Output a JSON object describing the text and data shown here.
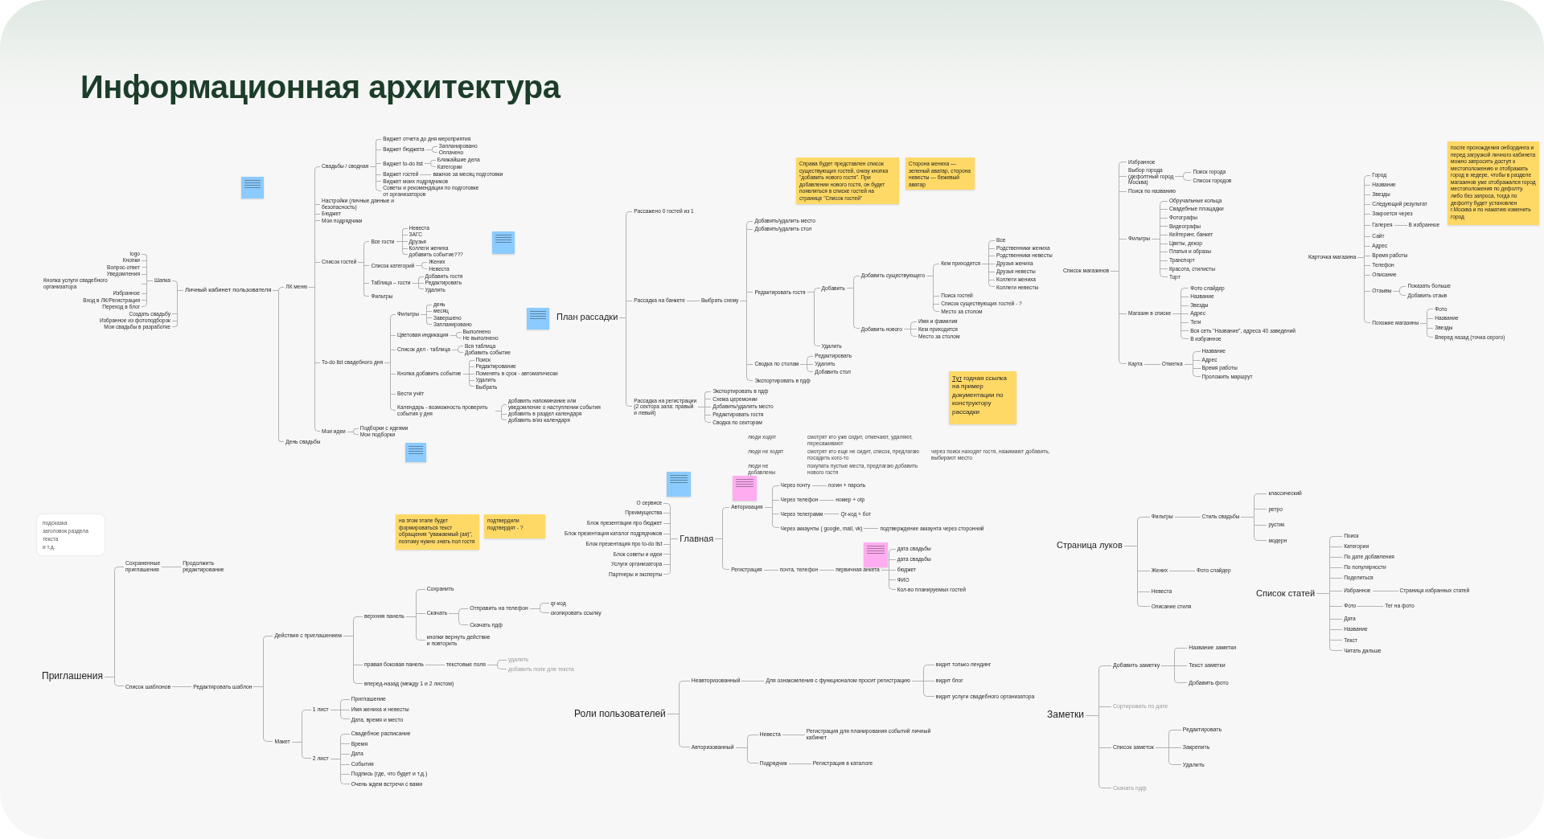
{
  "title": "Информационная архитектура",
  "maps": [
    {
      "title": "Личный кабинет пользователя",
      "left_children": [
        {
          "label": "Шапка",
          "children": [
            {
              "label": "logo"
            },
            {
              "label": "Кнопки"
            },
            {
              "label": "Вопрос-ответ"
            },
            {
              "label": "Уведомления"
            },
            {
              "label": "Кнопка услуги свадебного организатора"
            },
            {
              "label": "Избранное"
            },
            {
              "label": "Вход в ЛК/Регистрация"
            },
            {
              "label": "Переход в блог"
            }
          ]
        },
        {
          "label": "Создать свадьбу"
        },
        {
          "label": "Избранное из фотоподборок"
        },
        {
          "label": "Мои свадьбы в разработке"
        }
      ],
      "children": [
        {
          "label": "ЛК меню",
          "children": [
            {
              "label": "Свадьбы / сводная",
              "children": [
                {
                  "label": "Виджет отчета до дня мероприятия"
                },
                {
                  "label": "Виджет бюджета",
                  "children": [
                    {
                      "label": "Запланировано"
                    },
                    {
                      "label": "Оплачено"
                    }
                  ]
                },
                {
                  "label": "Виджет to-do list",
                  "children": [
                    {
                      "label": "Ближайшие дела"
                    },
                    {
                      "label": "Категории"
                    }
                  ]
                },
                {
                  "label": "Виджет гостей",
                  "children": [
                    {
                      "label": "важное за месяц подготовки"
                    }
                  ]
                },
                {
                  "label": "Виджет моих подрядчиков"
                },
                {
                  "label": "Советы и рекомендации по подготовке от организаторов"
                }
              ]
            },
            {
              "label": "Настройки (личные данные и безопасность)"
            },
            {
              "label": "Бюджет"
            },
            {
              "label": "Мои подрядчики"
            },
            {
              "label": "Список гостей",
              "children": [
                {
                  "label": "Все гости",
                  "children": [
                    {
                      "label": "Невеста"
                    },
                    {
                      "label": "ЗАГС"
                    },
                    {
                      "label": "Друзья"
                    },
                    {
                      "label": "Коллеги жениха"
                    },
                    {
                      "label": "добавить событие???"
                    }
                  ]
                },
                {
                  "label": "Список категорий",
                  "children": [
                    {
                      "label": "Жених"
                    },
                    {
                      "label": "Невеста"
                    }
                  ]
                },
                {
                  "label": "Таблица – гости",
                  "children": [
                    {
                      "label": "Добавить гостя"
                    },
                    {
                      "label": "Редактировать"
                    },
                    {
                      "label": "Удалить"
                    }
                  ]
                },
                {
                  "label": "Фильтры"
                }
              ]
            },
            {
              "label": "To-do list свадебного дня",
              "children": [
                {
                  "label": "Фильтры",
                  "children": [
                    {
                      "label": "день"
                    },
                    {
                      "label": "месяц"
                    },
                    {
                      "label": "Завершено"
                    },
                    {
                      "label": "Запланировано"
                    }
                  ]
                },
                {
                  "label": "Цветовая индикация",
                  "children": [
                    {
                      "label": "Выполнено"
                    },
                    {
                      "label": "Не выполнено"
                    }
                  ]
                },
                {
                  "label": "Список дел - таблица",
                  "children": [
                    {
                      "label": "Вся таблица"
                    },
                    {
                      "label": "Добавить событие"
                    }
                  ]
                },
                {
                  "label": "Кнопка добавить событие",
                  "children": [
                    {
                      "label": "Поиск"
                    },
                    {
                      "label": "Редактирование"
                    },
                    {
                      "label": "Поменять в срок - автоматически"
                    },
                    {
                      "label": "Удалить"
                    },
                    {
                      "label": "Выбрать"
                    }
                  ]
                },
                {
                  "label": "Вести учёт"
                },
                {
                  "label": "Календарь - возможность проверить события у дня",
                  "children": [
                    {
                      "label": "добавить напоминание или уведомление о наступлении события"
                    },
                    {
                      "label": "добавить в раздел календаря"
                    },
                    {
                      "label": "добавить в/из календаря"
                    }
                  ]
                }
              ]
            },
            {
              "label": "Мои идеи",
              "children": [
                {
                  "label": "Подборки с идеями"
                },
                {
                  "label": "Мои подборки"
                }
              ]
            }
          ]
        },
        {
          "label": "День свадьбы"
        }
      ]
    },
    {
      "title": "План рассадки",
      "children": [
        {
          "label": "Рассажено 0 гостей из 1"
        },
        {
          "label": "Рассадка на банкете",
          "children": [
            {
              "label": "Выбрать схему",
              "children": [
                {
                  "label": "Добавить/удалить место"
                },
                {
                  "label": "Добавить/удалить стол"
                },
                {
                  "label": "Редактировать гостя",
                  "children": [
                    {
                      "label": "Добавить",
                      "children": [
                        {
                          "label": "Добавить существующего",
                          "children": [
                            {
                              "label": "Кем приходится",
                              "children": [
                                {
                                  "label": "Все"
                                },
                                {
                                  "label": "Родственники жениха"
                                },
                                {
                                  "label": "Родственники невесты"
                                },
                                {
                                  "label": "Друзья жениха"
                                },
                                {
                                  "label": "Друзья невесты"
                                },
                                {
                                  "label": "Коллеги жениха"
                                },
                                {
                                  "label": "Коллеги невесты"
                                }
                              ]
                            },
                            {
                              "label": "Поиск гостей"
                            },
                            {
                              "label": "Список существующих гостей - ?"
                            },
                            {
                              "label": "Место за столом"
                            }
                          ]
                        },
                        {
                          "label": "Добавить нового",
                          "children": [
                            {
                              "label": "Имя и фамилия"
                            },
                            {
                              "label": "Кем приходится"
                            },
                            {
                              "label": "Место за столом"
                            }
                          ]
                        }
                      ]
                    },
                    {
                      "label": "Удалить"
                    }
                  ]
                },
                {
                  "label": "Сводка по столам",
                  "children": [
                    {
                      "label": "Редактировать"
                    },
                    {
                      "label": "Удалить"
                    },
                    {
                      "label": "Добавить стол"
                    }
                  ]
                },
                {
                  "label": "Экспортировать в пдф"
                }
              ]
            }
          ]
        },
        {
          "label": "Рассадка на регистрации\n(2 сектора зала: правый\nи левый)",
          "children": [
            {
              "label": "Экспортировать в пдф"
            },
            {
              "label": "Схема церемонии"
            },
            {
              "label": "Добавить/удалить место"
            },
            {
              "label": "Редактировать гостя"
            },
            {
              "label": "Сводка по секторам"
            }
          ]
        }
      ]
    },
    {
      "title": "Список магазинов",
      "children": [
        {
          "label": "Избранное"
        },
        {
          "label": "Выбор города\n(дефолтный город\nМосква)",
          "children": [
            {
              "label": "Поиск города"
            },
            {
              "label": "Список городов"
            }
          ]
        },
        {
          "label": "Поиск по названию"
        },
        {
          "label": "Фильтры",
          "children": [
            {
              "label": "Обручальные кольца"
            },
            {
              "label": "Свадебные площадки"
            },
            {
              "label": "Фотографы"
            },
            {
              "label": "Видеографы"
            },
            {
              "label": "Кейтеринг, банкет"
            },
            {
              "label": "Цветы, декор"
            },
            {
              "label": "Платья и образы"
            },
            {
              "label": "Транспорт"
            },
            {
              "label": "Красота, стилисты"
            },
            {
              "label": "Торт"
            }
          ]
        },
        {
          "label": "Магазин в списке",
          "children": [
            {
              "label": "Фото слайдер"
            },
            {
              "label": "Название"
            },
            {
              "label": "Звезды"
            },
            {
              "label": "Адрес"
            },
            {
              "label": "Теги"
            },
            {
              "label": "Вся сеть \"Название\", адреса 40 заведений"
            },
            {
              "label": "В избранное"
            }
          ]
        },
        {
          "label": "Карта",
          "children": [
            {
              "label": "Отметка",
              "children": [
                {
                  "label": "Название"
                },
                {
                  "label": "Адрес"
                },
                {
                  "label": "Время работы"
                },
                {
                  "label": "Проложить маршрут"
                }
              ]
            }
          ]
        }
      ]
    },
    {
      "title": "Карточка магазина",
      "children": [
        {
          "label": "Город"
        },
        {
          "label": "Название"
        },
        {
          "label": "Звезды"
        },
        {
          "label": "Следующий результат"
        },
        {
          "label": "Закроется через"
        },
        {
          "label": "Галерея",
          "children": [
            {
              "label": "В избранное"
            }
          ]
        },
        {
          "label": "Сайт"
        },
        {
          "label": "Адрес"
        },
        {
          "label": "Время работы"
        },
        {
          "label": "Телефон"
        },
        {
          "label": "Описание"
        },
        {
          "label": "Отзывы",
          "children": [
            {
              "label": "Показать больше"
            },
            {
              "label": "Добавить отзыв"
            }
          ]
        },
        {
          "label": "Похожие магазины",
          "children": [
            {
              "label": "Фото"
            },
            {
              "label": "Название"
            },
            {
              "label": "Звезды"
            },
            {
              "label": "Вперед назад (точка серого)"
            }
          ]
        }
      ]
    },
    {
      "title": "Главная",
      "left_children": [
        {
          "label": "О сервисе"
        },
        {
          "label": "Преимущества"
        },
        {
          "label": "Блок презентации про бюджет"
        },
        {
          "label": "Блок презентация каталог подрядчиков"
        },
        {
          "label": "Блок презентация про to-do list"
        },
        {
          "label": "Блок советы и идеи"
        },
        {
          "label": "Услуги организатора"
        },
        {
          "label": "Партнеры и эксперты"
        }
      ],
      "children": [
        {
          "label": "Авторизация",
          "children": [
            {
              "label": "Через почту",
              "children": [
                {
                  "label": "логин + пароль"
                }
              ]
            },
            {
              "label": "Через телефон",
              "children": [
                {
                  "label": "номер + otp"
                }
              ]
            },
            {
              "label": "Через телеграмм",
              "children": [
                {
                  "label": "Qr-код + бот"
                }
              ]
            },
            {
              "label": "Через аккаунты ( google, mail, vk)",
              "children": [
                {
                  "label": "подтверждение аккаунта через сторонний"
                }
              ]
            }
          ]
        },
        {
          "label": "Регистрация",
          "children": [
            {
              "label": "почта, телефон",
              "children": [
                {
                  "label": "первичная анкета",
                  "children": [
                    {
                      "label": "дата свадьбы"
                    },
                    {
                      "label": "дата свадьбы"
                    },
                    {
                      "label": "бюджет"
                    },
                    {
                      "label": "ФИО"
                    },
                    {
                      "label": "Кол-во планируемых гостей"
                    }
                  ]
                }
              ]
            }
          ]
        }
      ]
    },
    {
      "title": "Роли пользователей",
      "children": [
        {
          "label": "Неавторизованный",
          "children": [
            {
              "label": "Для ознакомления с функционалом просит регистрацию",
              "children": [
                {
                  "label": "видит только лендинг"
                },
                {
                  "label": "видит блог"
                },
                {
                  "label": "видит услуги свадебного организатора"
                }
              ]
            }
          ]
        },
        {
          "label": "Авторизованный",
          "children": [
            {
              "label": "Невеста",
              "children": [
                {
                  "label": "Регистрация для планирования событий личный\nкабинет"
                }
              ]
            },
            {
              "label": "Подрядчик",
              "children": [
                {
                  "label": "Регистрация в каталоге"
                }
              ]
            }
          ]
        }
      ]
    },
    {
      "title": "Приглашения",
      "children": [
        {
          "label": "Сохраненные\nприглашения",
          "children": [
            {
              "label": "Продолжить\nредактирование"
            }
          ]
        },
        {
          "label": "Список шаблонов",
          "children": [
            {
              "label": "Редактировать шаблон",
              "children": [
                {
                  "label": "Действия с приглашением",
                  "children": [
                    {
                      "label": "верхняя панель",
                      "children": [
                        {
                          "label": "Сохранить"
                        },
                        {
                          "label": "Скачать",
                          "children": [
                            {
                              "label": "Отправить на телефон",
                              "children": [
                                {
                                  "label": "qr-код"
                                },
                                {
                                  "label": "скопировать ссылку"
                                }
                              ]
                            },
                            {
                              "label": "Скачать пдф"
                            }
                          ]
                        },
                        {
                          "label": "кнопки вернуть действие\nи повторить"
                        }
                      ]
                    },
                    {
                      "label": "правая боковая панель",
                      "children": [
                        {
                          "label": "текстовые поля",
                          "children": [
                            {
                              "label": "удалить",
                              "muted": true
                            },
                            {
                              "label": "добавить поле для текста",
                              "muted": true
                            }
                          ]
                        }
                      ]
                    },
                    {
                      "label": "вперед-назад (между 1 и 2 листом)"
                    }
                  ]
                },
                {
                  "label": "Макет",
                  "children": [
                    {
                      "label": "1 лист",
                      "children": [
                        {
                          "label": "Приглашение"
                        },
                        {
                          "label": "Имя жениха и невесты"
                        },
                        {
                          "label": "Дата, время и место"
                        }
                      ]
                    },
                    {
                      "label": "2 лист",
                      "children": [
                        {
                          "label": "Свадебное расписание"
                        },
                        {
                          "label": "Время"
                        },
                        {
                          "label": "Дата"
                        },
                        {
                          "label": "События"
                        },
                        {
                          "label": "Подпись (где, что будет и т.д.)"
                        },
                        {
                          "label": "Очень ждем встречи с вами"
                        }
                      ]
                    }
                  ]
                }
              ]
            }
          ]
        }
      ]
    },
    {
      "title": "Страница луков",
      "children": [
        {
          "label": "Фильтры",
          "children": [
            {
              "label": "Стиль свадьбы",
              "children": [
                {
                  "label": "классический"
                },
                {
                  "label": "ретро"
                },
                {
                  "label": "рустик"
                },
                {
                  "label": "модерн"
                }
              ]
            }
          ]
        },
        {
          "label": "Жених",
          "children": [
            {
              "label": "Фото слайдер"
            }
          ]
        },
        {
          "label": "Невеста"
        },
        {
          "label": "Описание стиля"
        }
      ]
    },
    {
      "title": "Список статей",
      "children": [
        {
          "label": "Поиск"
        },
        {
          "label": "Категории"
        },
        {
          "label": "По дате добавления"
        },
        {
          "label": "По популярности"
        },
        {
          "label": "Поделиться"
        },
        {
          "label": "Избранное",
          "children": [
            {
              "label": "Страница избранных статей"
            }
          ]
        },
        {
          "label": "Фото",
          "children": [
            {
              "label": "Тег на фото"
            }
          ]
        },
        {
          "label": "Дата"
        },
        {
          "label": "Название"
        },
        {
          "label": "Текст"
        },
        {
          "label": "Читать дальше"
        }
      ]
    },
    {
      "title": "Заметки",
      "children": [
        {
          "label": "Добавить заметку",
          "muted": false,
          "children": [
            {
              "label": "Название заметки"
            },
            {
              "label": "Текст заметки"
            },
            {
              "label": "Добавить фото"
            }
          ]
        },
        {
          "label": "Сортировать по дате",
          "muted": true
        },
        {
          "label": "Список заметок",
          "muted": false,
          "children": [
            {
              "label": "Редактировать"
            },
            {
              "label": "Закрепить"
            },
            {
              "label": "Удалить"
            }
          ]
        },
        {
          "label": "Скачать пдф",
          "muted": true
        }
      ]
    }
  ],
  "notes": [
    {
      "color": "#ffd966",
      "text": "Справа будет представлен список существующих гостей, снизу кнопка \"добавить нового гостя\". При добавлении нового гостя, он будет появляться в списке гостей на странице \"Список гостей\""
    },
    {
      "color": "#ffd966",
      "text": "Сторона жениха — зеленый аватар, сторона невесты — бежевый аватар"
    },
    {
      "color": "#ffd966",
      "link": "Тут",
      "text": "годная ссылка на пример документации по конструктору рассадки"
    },
    {
      "color": "#ffd966",
      "text": "после прохождения онбординга и перед загрузкой личного кабинета можно запросить доступ к местоположению и отображать город в хедере, чтобы в разделе магазинов уже отображался город местоположения по дефолту. либо без запроса, тогда по дефолту будет установлен г.Москва и по нажатию изменить город"
    },
    {
      "color": "#ffd966",
      "text": "на этом этапе будет формироваться текст обращения \"уважаемый (ая)\", поэтому нужно знать пол гостя"
    },
    {
      "color": "#ffd966",
      "text": "подтвердили подтвердят - ?"
    },
    {
      "color": "#8ccbff"
    },
    {
      "color": "#8ccbff"
    },
    {
      "color": "#8ccbff"
    },
    {
      "color": "#8ccbff"
    },
    {
      "color": "#8ccbff"
    },
    {
      "color": "#ffadf0"
    },
    {
      "color": "#ffadf0"
    }
  ],
  "seating_table": [
    {
      "label": "люди ходят",
      "text": "смотрят кто уже сидит, отмечают, удаляют, пересаживают"
    },
    {
      "label": "люди не ходят",
      "text": "смотрят кто еще не сидит, список, предлагаю посадить кого-то",
      "extra": "через поиск находят гостя, нажимают добавить, выбирают место"
    },
    {
      "label": "люди не добавлены",
      "text": "покупать пустые места, предлагаю добавить нового гостя"
    }
  ],
  "legend": [
    "подсказка",
    "заголовок раздела",
    "текста",
    "и т.д."
  ]
}
